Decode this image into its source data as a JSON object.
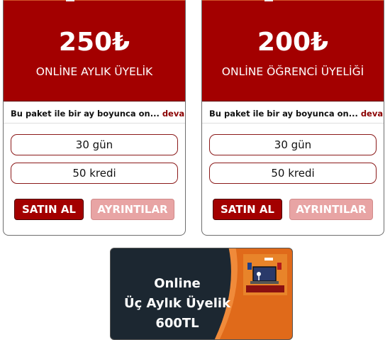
{
  "cards": [
    {
      "price": "250₺",
      "name": "ONLİNE AYLIK ÜYELİK",
      "description": "Bu paket ile bir ay boyunca on...",
      "more_label": "devamı...",
      "duration": "30 gün",
      "credits": "50 kredi",
      "buy_label": "SATIN AL",
      "details_label": "AYRINTILAR"
    },
    {
      "price": "200₺",
      "name": "ONLİNE ÖĞRENCİ ÜYELİĞİ",
      "description": "Bu paket ile bir ay boyunca on...",
      "more_label": "devamı...",
      "duration": "30 gün",
      "credits": "50 kredi",
      "buy_label": "SATIN AL",
      "details_label": "AYRINTILAR"
    }
  ],
  "promo": {
    "line1": "Online",
    "line2": "Üç Aylık Üyelik",
    "line3": "600TL"
  },
  "colors": {
    "accent": "#a30000",
    "accent_light": "#e8a4a4",
    "promo_dark": "#1c2731",
    "promo_orange": "#e06a1a"
  }
}
